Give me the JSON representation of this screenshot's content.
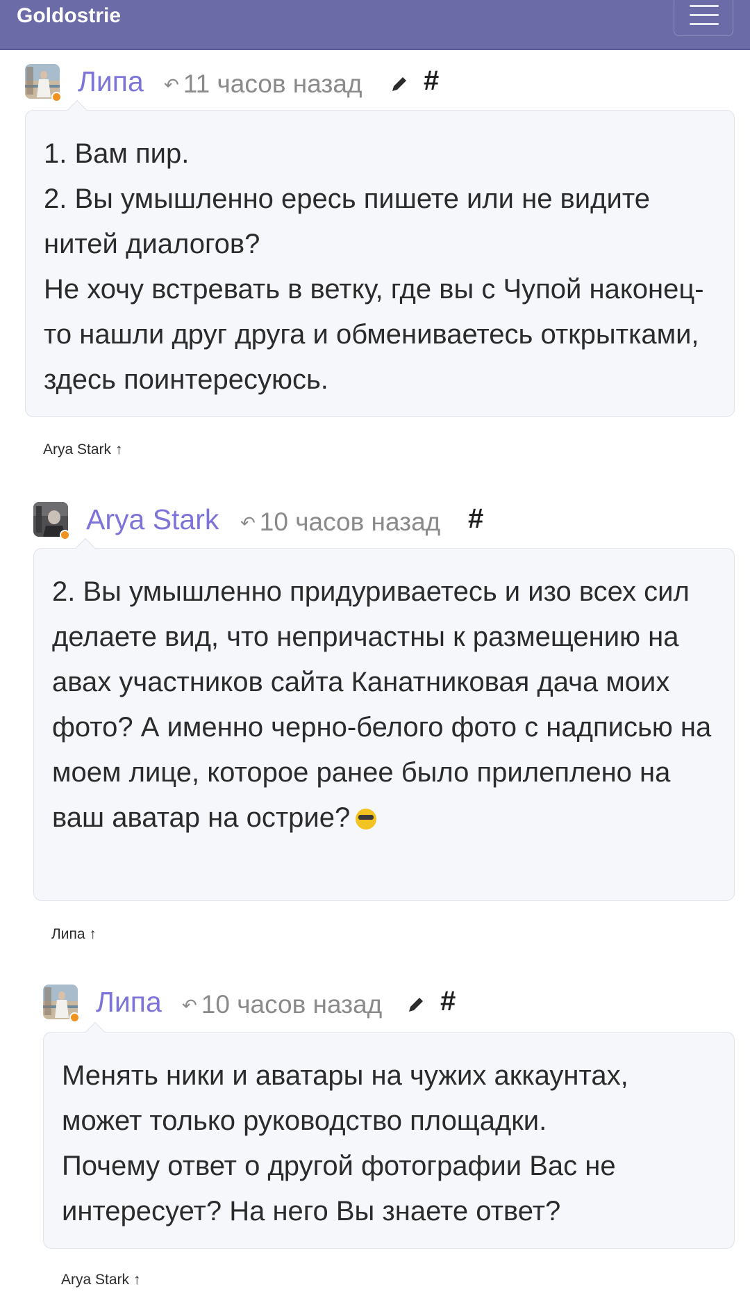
{
  "header": {
    "site_title": "Goldostrie",
    "menu_icon": "hamburger-menu-icon",
    "bg_color": "#6b6ba8"
  },
  "accent_color": "#7d74d8",
  "status_dot_color": "#f0921f",
  "comments": [
    {
      "author": "Липа",
      "time": "11 часов назад",
      "history_icon": "↶",
      "editable": true,
      "permalink": "#",
      "paragraphs": [
        "1. Вам пир.",
        "2. Вы умышленно ересь пишете или не видите нитей диалогов?",
        "Не хочу встревать в ветку, где вы с Чупой наконец-то нашли друг друга и обмениваетесь открытками, здесь поинтересуюсь."
      ],
      "reply_to": "Arya Stark ↑"
    },
    {
      "author": "Arya Stark",
      "time": "10 часов назад",
      "history_icon": "↶",
      "editable": false,
      "permalink": "#",
      "paragraphs": [
        "2. Вы умышленно придуриваетесь и изо всех сил делаете вид, что непричастны к размещению на авах участников сайта Канатниковая дача моих фото? А именно черно-белого фото с надписью на моем лице, которое ранее было прилеплено на ваш аватар на острие?"
      ],
      "emoji": "sunglasses-emoji",
      "reply_to": "Липа ↑"
    },
    {
      "author": "Липа",
      "time": "10 часов назад",
      "history_icon": "↶",
      "editable": true,
      "permalink": "#",
      "paragraphs": [
        "Менять ники и аватары на чужих аккаунтах, может только руководство площадки.",
        "Почему ответ о другой фотографии Вас не интересует? На него Вы знаете ответ?"
      ],
      "reply_to": "Arya Stark ↑"
    }
  ]
}
